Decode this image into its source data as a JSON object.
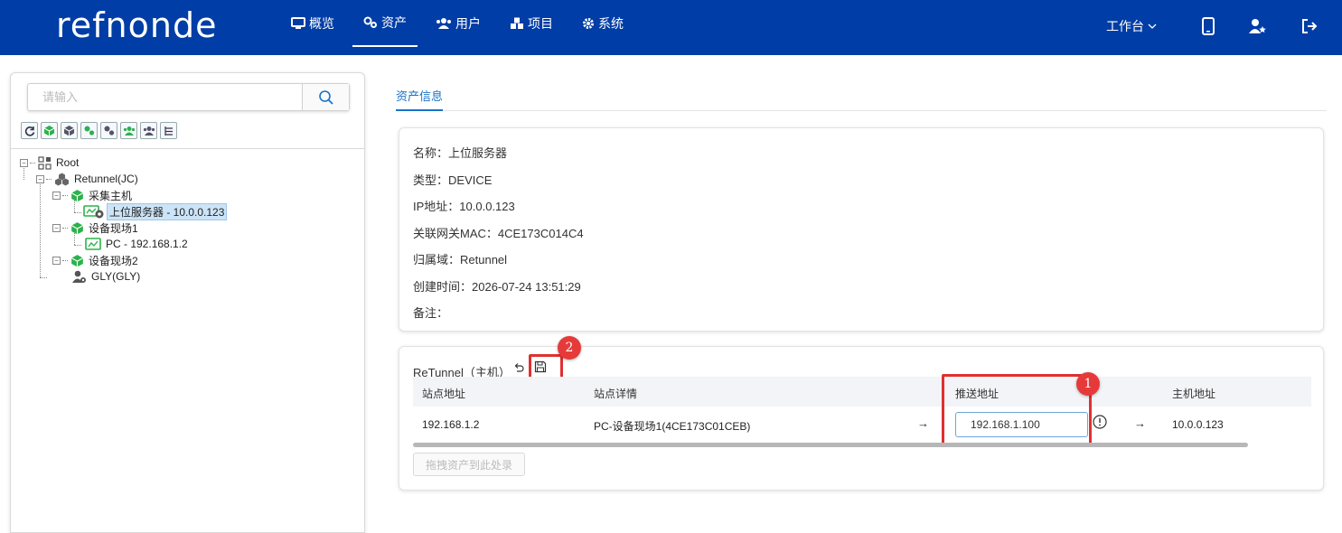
{
  "header": {
    "logo": "refnonde",
    "nav": [
      {
        "label": "概览",
        "icon": "monitor-icon"
      },
      {
        "label": "资产",
        "icon": "cogs-icon"
      },
      {
        "label": "用户",
        "icon": "users-icon"
      },
      {
        "label": "项目",
        "icon": "cubes-icon"
      },
      {
        "label": "系统",
        "icon": "gear-icon"
      }
    ],
    "workbench_label": "工作台",
    "accent": "#003da6"
  },
  "left": {
    "search_placeholder": "请输入",
    "tree": {
      "root": "Root",
      "domain": "Retunnel(JC)",
      "group1": "采集主机",
      "group1_child": "上位服务器 - 10.0.0.123",
      "group2": "设备现场1",
      "group2_child": "PC - 192.168.1.2",
      "group3": "设备现场2",
      "user": "GLY(GLY)"
    }
  },
  "main": {
    "tab_label": "资产信息",
    "info": {
      "name_key": "名称：",
      "name_val": "上位服务器",
      "type_key": "类型：",
      "type_val": "DEVICE",
      "ip_key": "IP地址：",
      "ip_val": "10.0.0.123",
      "mac_key": "关联网关MAC：",
      "mac_val": "4CE173C014C4",
      "domain_key": "归属域：",
      "domain_val": "Retunnel",
      "created_key": "创建时间：",
      "created_val": "2026-07-24 13:51:29",
      "note_key": "备注：",
      "note_val": ""
    },
    "retunnel": {
      "title": "ReTunnel（主机）",
      "headers": {
        "site_addr": "站点地址",
        "site_detail": "站点详情",
        "push_addr": "推送地址",
        "host_addr": "主机地址"
      },
      "row": {
        "site_addr": "192.168.1.2",
        "site_detail": "PC-设备现场1(4CE173C01CEB)",
        "arrow1": "→",
        "push_addr": "192.168.1.100",
        "arrow2": "→",
        "host_addr": "10.0.0.123"
      },
      "drop_label": "拖拽资产到此处录",
      "badge1": "1",
      "badge2": "2"
    }
  }
}
